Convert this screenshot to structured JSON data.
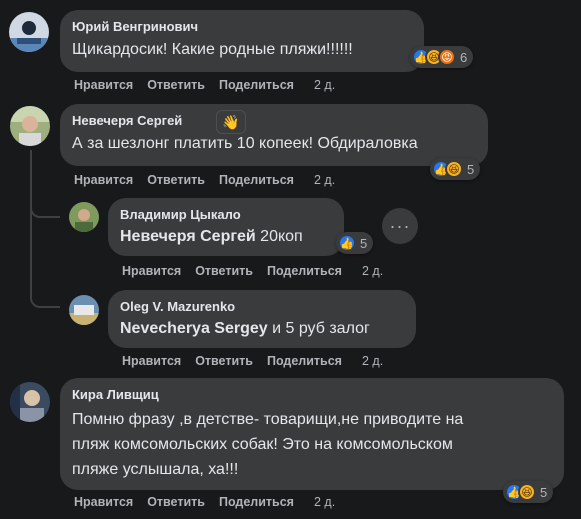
{
  "comments": [
    {
      "author": "Юрий Венгринович",
      "text": "Щикардосик! Какие родные пляжи!!!!!!",
      "reaction_count": "6",
      "actions": {
        "like": "Нравится",
        "reply": "Ответить",
        "share": "Поделиться",
        "time": "2 д."
      }
    },
    {
      "author": "Невечеря Сергей",
      "text": "А за шезлонг платить 10 копеек! Обдираловка",
      "reaction_count": "5",
      "actions": {
        "like": "Нравится",
        "reply": "Ответить",
        "share": "Поделиться",
        "time": "2 д."
      }
    },
    {
      "author": "Владимир Цыкало",
      "mention": "Невечеря Сергей",
      "text": " 20коп",
      "reaction_count": "5",
      "actions": {
        "like": "Нравится",
        "reply": "Ответить",
        "share": "Поделиться",
        "time": "2 д."
      }
    },
    {
      "author": "Oleg V. Mazurenko",
      "mention": "Nevecherya Sergey",
      "text": " и 5 руб залог",
      "actions": {
        "like": "Нравится",
        "reply": "Ответить",
        "share": "Поделиться",
        "time": "2 д."
      }
    },
    {
      "author": "Кира Ливщиц",
      "text": "Помню фразу ,в детстве- товарищи,не приводите на\nпляж комсомольских собак! Это на комсомольском\nпляже услышала, ха!!!",
      "reaction_count": "5",
      "actions": {
        "like": "Нравится",
        "reply": "Ответить",
        "share": "Поделиться",
        "time": "2 д."
      }
    }
  ],
  "colors": {
    "background": "#18191a",
    "bubble": "#3a3b3c",
    "text": "#e4e6eb",
    "secondary_text": "#b0b3b8",
    "like_blue": "#2078f4",
    "haha_yellow": "#f7b125"
  },
  "icons": [
    "like-reaction-icon",
    "haha-reaction-icon",
    "angry-reaction-icon",
    "wave-icon",
    "more-options-icon"
  ]
}
